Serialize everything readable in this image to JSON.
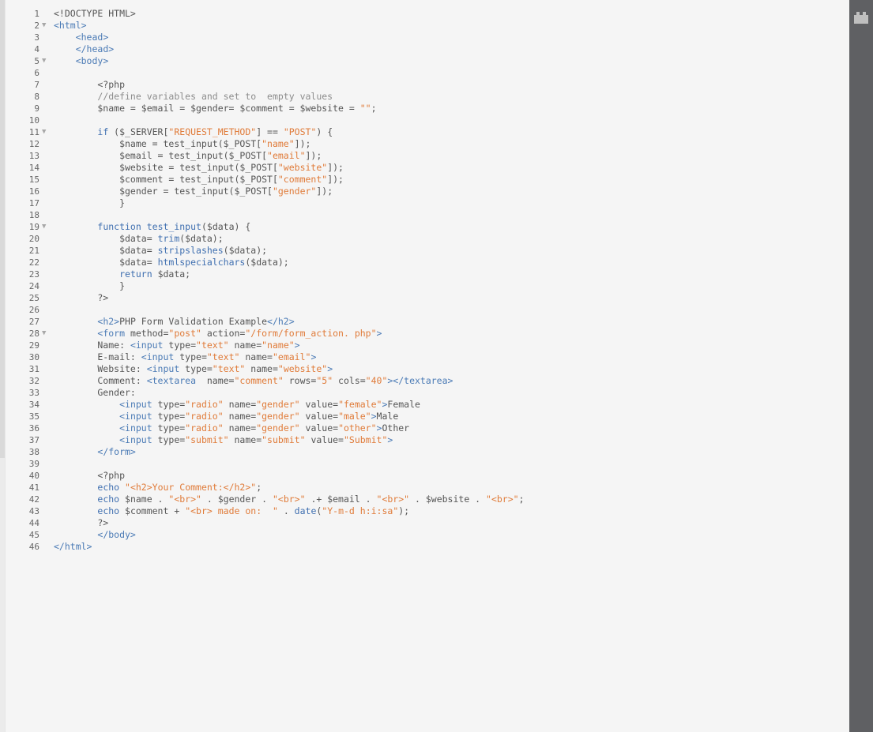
{
  "colors": {
    "tag": "#4a7ab5",
    "string": "#e07b39",
    "comment": "#8c8c8c",
    "keyword": "#3f6fb0",
    "plain": "#555555",
    "background": "#f5f5f5",
    "side_panel": "#5f6063"
  },
  "side_panel": {
    "icon": "plugin-icon"
  },
  "fold_marker": "▼",
  "code_lines": [
    {
      "n": "1",
      "fold": false,
      "segs": [
        [
          "plain",
          "<!DOCTYPE HTML>"
        ]
      ]
    },
    {
      "n": "2",
      "fold": true,
      "segs": [
        [
          "tag",
          "<html>"
        ]
      ]
    },
    {
      "n": "3",
      "fold": false,
      "segs": [
        [
          "plain",
          "    "
        ],
        [
          "tag",
          "<head>"
        ]
      ]
    },
    {
      "n": "4",
      "fold": false,
      "segs": [
        [
          "plain",
          "    "
        ],
        [
          "tag",
          "</head>"
        ]
      ]
    },
    {
      "n": "5",
      "fold": true,
      "segs": [
        [
          "plain",
          "    "
        ],
        [
          "tag",
          "<body>"
        ]
      ]
    },
    {
      "n": "6",
      "fold": false,
      "segs": []
    },
    {
      "n": "7",
      "fold": false,
      "segs": [
        [
          "plain",
          "        <?php"
        ]
      ]
    },
    {
      "n": "8",
      "fold": false,
      "segs": [
        [
          "plain",
          "        "
        ],
        [
          "com",
          "//define variables and set to  empty values"
        ]
      ]
    },
    {
      "n": "9",
      "fold": false,
      "segs": [
        [
          "plain",
          "        $name = $email = $gender= $comment = $website = "
        ],
        [
          "str",
          "\"\""
        ],
        [
          "plain",
          ";"
        ]
      ]
    },
    {
      "n": "10",
      "fold": false,
      "segs": []
    },
    {
      "n": "11",
      "fold": true,
      "segs": [
        [
          "plain",
          "        "
        ],
        [
          "kw",
          "if"
        ],
        [
          "plain",
          " ($_SERVER["
        ],
        [
          "str",
          "\"REQUEST_METHOD\""
        ],
        [
          "plain",
          "] == "
        ],
        [
          "str",
          "\"POST\""
        ],
        [
          "plain",
          ") {"
        ]
      ]
    },
    {
      "n": "12",
      "fold": false,
      "segs": [
        [
          "plain",
          "            $name = test_input($_POST["
        ],
        [
          "str",
          "\"name\""
        ],
        [
          "plain",
          "]);"
        ]
      ]
    },
    {
      "n": "13",
      "fold": false,
      "segs": [
        [
          "plain",
          "            $email = test_input($_POST["
        ],
        [
          "str",
          "\"email\""
        ],
        [
          "plain",
          "]);"
        ]
      ]
    },
    {
      "n": "14",
      "fold": false,
      "segs": [
        [
          "plain",
          "            $website = test_input($_POST["
        ],
        [
          "str",
          "\"website\""
        ],
        [
          "plain",
          "]);"
        ]
      ]
    },
    {
      "n": "15",
      "fold": false,
      "segs": [
        [
          "plain",
          "            $comment = test_input($_POST["
        ],
        [
          "str",
          "\"comment\""
        ],
        [
          "plain",
          "]);"
        ]
      ]
    },
    {
      "n": "16",
      "fold": false,
      "segs": [
        [
          "plain",
          "            $gender = test_input($_POST["
        ],
        [
          "str",
          "\"gender\""
        ],
        [
          "plain",
          "]);"
        ]
      ]
    },
    {
      "n": "17",
      "fold": false,
      "segs": [
        [
          "plain",
          "            }"
        ]
      ]
    },
    {
      "n": "18",
      "fold": false,
      "segs": []
    },
    {
      "n": "19",
      "fold": true,
      "segs": [
        [
          "plain",
          "        "
        ],
        [
          "kw",
          "function"
        ],
        [
          "plain",
          " "
        ],
        [
          "fn",
          "test_input"
        ],
        [
          "plain",
          "($data) {"
        ]
      ]
    },
    {
      "n": "20",
      "fold": false,
      "segs": [
        [
          "plain",
          "            $data= "
        ],
        [
          "fn",
          "trim"
        ],
        [
          "plain",
          "($data);"
        ]
      ]
    },
    {
      "n": "21",
      "fold": false,
      "segs": [
        [
          "plain",
          "            $data= "
        ],
        [
          "fn",
          "stripslashes"
        ],
        [
          "plain",
          "($data);"
        ]
      ]
    },
    {
      "n": "22",
      "fold": false,
      "segs": [
        [
          "plain",
          "            $data= "
        ],
        [
          "fn",
          "htmlspecialchars"
        ],
        [
          "plain",
          "($data);"
        ]
      ]
    },
    {
      "n": "23",
      "fold": false,
      "segs": [
        [
          "plain",
          "            "
        ],
        [
          "kw",
          "return"
        ],
        [
          "plain",
          " $data;"
        ]
      ]
    },
    {
      "n": "24",
      "fold": false,
      "segs": [
        [
          "plain",
          "            }"
        ]
      ]
    },
    {
      "n": "25",
      "fold": false,
      "segs": [
        [
          "plain",
          "        ?>"
        ]
      ]
    },
    {
      "n": "26",
      "fold": false,
      "segs": []
    },
    {
      "n": "27",
      "fold": false,
      "segs": [
        [
          "plain",
          "        "
        ],
        [
          "tag",
          "<h2>"
        ],
        [
          "plain",
          "PHP Form Validation Example"
        ],
        [
          "tag",
          "</h2>"
        ]
      ]
    },
    {
      "n": "28",
      "fold": true,
      "segs": [
        [
          "plain",
          "        "
        ],
        [
          "tag",
          "<form"
        ],
        [
          "plain",
          " method="
        ],
        [
          "str",
          "\"post\""
        ],
        [
          "plain",
          " action="
        ],
        [
          "str",
          "\"/form/form_action. php\""
        ],
        [
          "tag",
          ">"
        ]
      ]
    },
    {
      "n": "29",
      "fold": false,
      "segs": [
        [
          "plain",
          "        Name: "
        ],
        [
          "tag",
          "<input"
        ],
        [
          "plain",
          " type="
        ],
        [
          "str",
          "\"text\""
        ],
        [
          "plain",
          " name="
        ],
        [
          "str",
          "\"name\""
        ],
        [
          "tag",
          ">"
        ]
      ]
    },
    {
      "n": "30",
      "fold": false,
      "segs": [
        [
          "plain",
          "        E-mail: "
        ],
        [
          "tag",
          "<input"
        ],
        [
          "plain",
          " type="
        ],
        [
          "str",
          "\"text\""
        ],
        [
          "plain",
          " name="
        ],
        [
          "str",
          "\"email\""
        ],
        [
          "tag",
          ">"
        ]
      ]
    },
    {
      "n": "31",
      "fold": false,
      "segs": [
        [
          "plain",
          "        Website: "
        ],
        [
          "tag",
          "<input"
        ],
        [
          "plain",
          " type="
        ],
        [
          "str",
          "\"text\""
        ],
        [
          "plain",
          " name="
        ],
        [
          "str",
          "\"website\""
        ],
        [
          "tag",
          ">"
        ]
      ]
    },
    {
      "n": "32",
      "fold": false,
      "segs": [
        [
          "plain",
          "        Comment: "
        ],
        [
          "tag",
          "<textarea"
        ],
        [
          "plain",
          "  name="
        ],
        [
          "str",
          "\"comment\""
        ],
        [
          "plain",
          " rows="
        ],
        [
          "str",
          "\"5\""
        ],
        [
          "plain",
          " cols="
        ],
        [
          "str",
          "\"40\""
        ],
        [
          "tag",
          "></textarea>"
        ]
      ]
    },
    {
      "n": "33",
      "fold": false,
      "segs": [
        [
          "plain",
          "        Gender:"
        ]
      ]
    },
    {
      "n": "34",
      "fold": false,
      "segs": [
        [
          "plain",
          "            "
        ],
        [
          "tag",
          "<input"
        ],
        [
          "plain",
          " type="
        ],
        [
          "str",
          "\"radio\""
        ],
        [
          "plain",
          " name="
        ],
        [
          "str",
          "\"gender\""
        ],
        [
          "plain",
          " value="
        ],
        [
          "str",
          "\"female\""
        ],
        [
          "tag",
          ">"
        ],
        [
          "plain",
          "Female"
        ]
      ]
    },
    {
      "n": "35",
      "fold": false,
      "segs": [
        [
          "plain",
          "            "
        ],
        [
          "tag",
          "<input"
        ],
        [
          "plain",
          " type="
        ],
        [
          "str",
          "\"radio\""
        ],
        [
          "plain",
          " name="
        ],
        [
          "str",
          "\"gender\""
        ],
        [
          "plain",
          " value="
        ],
        [
          "str",
          "\"male\""
        ],
        [
          "tag",
          ">"
        ],
        [
          "plain",
          "Male"
        ]
      ]
    },
    {
      "n": "36",
      "fold": false,
      "segs": [
        [
          "plain",
          "            "
        ],
        [
          "tag",
          "<input"
        ],
        [
          "plain",
          " type="
        ],
        [
          "str",
          "\"radio\""
        ],
        [
          "plain",
          " name="
        ],
        [
          "str",
          "\"gender\""
        ],
        [
          "plain",
          " value="
        ],
        [
          "str",
          "\"other\""
        ],
        [
          "tag",
          ">"
        ],
        [
          "plain",
          "Other"
        ]
      ]
    },
    {
      "n": "37",
      "fold": false,
      "segs": [
        [
          "plain",
          "            "
        ],
        [
          "tag",
          "<input"
        ],
        [
          "plain",
          " type="
        ],
        [
          "str",
          "\"submit\""
        ],
        [
          "plain",
          " name="
        ],
        [
          "str",
          "\"submit\""
        ],
        [
          "plain",
          " value="
        ],
        [
          "str",
          "\"Submit\""
        ],
        [
          "tag",
          ">"
        ]
      ]
    },
    {
      "n": "38",
      "fold": false,
      "segs": [
        [
          "plain",
          "        "
        ],
        [
          "tag",
          "</form>"
        ]
      ]
    },
    {
      "n": "39",
      "fold": false,
      "segs": []
    },
    {
      "n": "40",
      "fold": false,
      "segs": [
        [
          "plain",
          "        <?php"
        ]
      ]
    },
    {
      "n": "41",
      "fold": false,
      "segs": [
        [
          "plain",
          "        "
        ],
        [
          "kw",
          "echo"
        ],
        [
          "plain",
          " "
        ],
        [
          "str",
          "\"<h2>Your Comment:</h2>\""
        ],
        [
          "plain",
          ";"
        ]
      ]
    },
    {
      "n": "42",
      "fold": false,
      "segs": [
        [
          "plain",
          "        "
        ],
        [
          "kw",
          "echo"
        ],
        [
          "plain",
          " $name . "
        ],
        [
          "str",
          "\"<br>\""
        ],
        [
          "plain",
          " . $gender . "
        ],
        [
          "str",
          "\"<br>\""
        ],
        [
          "plain",
          " .+ $email . "
        ],
        [
          "str",
          "\"<br>\""
        ],
        [
          "plain",
          " . $website . "
        ],
        [
          "str",
          "\"<br>\""
        ],
        [
          "plain",
          ";"
        ]
      ]
    },
    {
      "n": "43",
      "fold": false,
      "segs": [
        [
          "plain",
          "        "
        ],
        [
          "kw",
          "echo"
        ],
        [
          "plain",
          " $comment + "
        ],
        [
          "str",
          "\"<br> made on:  \""
        ],
        [
          "plain",
          " . "
        ],
        [
          "fn",
          "date"
        ],
        [
          "plain",
          "("
        ],
        [
          "str",
          "\"Y-m-d h:i:sa\""
        ],
        [
          "plain",
          ");"
        ]
      ]
    },
    {
      "n": "44",
      "fold": false,
      "segs": [
        [
          "plain",
          "        ?>"
        ]
      ]
    },
    {
      "n": "45",
      "fold": false,
      "segs": [
        [
          "plain",
          "        "
        ],
        [
          "tag",
          "</body>"
        ]
      ]
    },
    {
      "n": "46",
      "fold": false,
      "segs": [
        [
          "tag",
          "</html>"
        ]
      ]
    }
  ]
}
